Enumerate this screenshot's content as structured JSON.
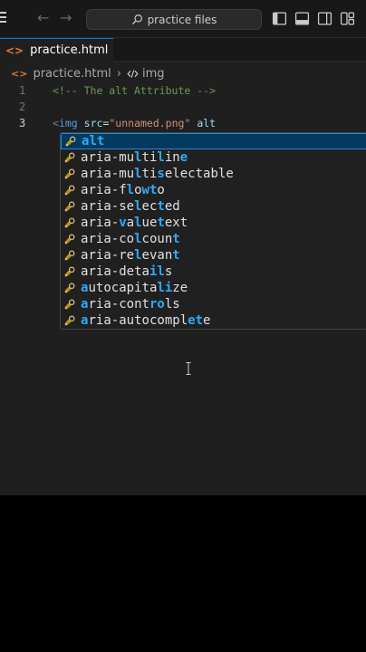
{
  "titlebar": {
    "search_text": "practice files",
    "icons": [
      "menu-icon",
      "arrow-left-icon",
      "arrow-right-icon",
      "search-icon",
      "toggle-primary-sidebar-icon",
      "toggle-panel-icon",
      "toggle-secondary-sidebar-icon",
      "customize-layout-icon"
    ]
  },
  "tab": {
    "label": "practice.html",
    "dirty": true,
    "icon": "html-file-icon"
  },
  "breadcrumb": {
    "file": "practice.html",
    "separator": "›",
    "symbol": "img",
    "symbol_icon": "symbol-element-icon"
  },
  "editor": {
    "line_numbers": [
      "1",
      "2",
      "3"
    ],
    "line1": {
      "comment": "<!-- The alt Attribute -->"
    },
    "line3": {
      "open": "<",
      "tag": "img",
      "attr1": "src",
      "eq": "=",
      "value": "\"unnamed.png\"",
      "attr2": "alt"
    }
  },
  "suggestions": [
    {
      "label": "alt",
      "match": [
        0,
        1,
        2
      ],
      "selected": true
    },
    {
      "label": "aria-multiline",
      "match": [
        7,
        10,
        13
      ]
    },
    {
      "label": "aria-multiselectable",
      "match": [
        7,
        10
      ]
    },
    {
      "label": "aria-flowto",
      "match": [
        6,
        8,
        9
      ]
    },
    {
      "label": "aria-selected",
      "match": [
        7,
        10
      ]
    },
    {
      "label": "aria-valuetext",
      "match": [
        5,
        7,
        10
      ]
    },
    {
      "label": "aria-colcount",
      "match": [
        7,
        12
      ]
    },
    {
      "label": "aria-relevant",
      "match": [
        7,
        12
      ]
    },
    {
      "label": "aria-details",
      "match": [
        9,
        10
      ]
    },
    {
      "label": "autocapitalize",
      "match": [
        0,
        10,
        11
      ]
    },
    {
      "label": "aria-controls",
      "match": [
        0,
        9,
        10
      ]
    },
    {
      "label": "aria-autocomplete",
      "match": [
        0,
        14,
        15
      ]
    }
  ],
  "colors": {
    "accent": "#0078d4",
    "highlight": "#2aaaff",
    "selection": "#04395e"
  }
}
